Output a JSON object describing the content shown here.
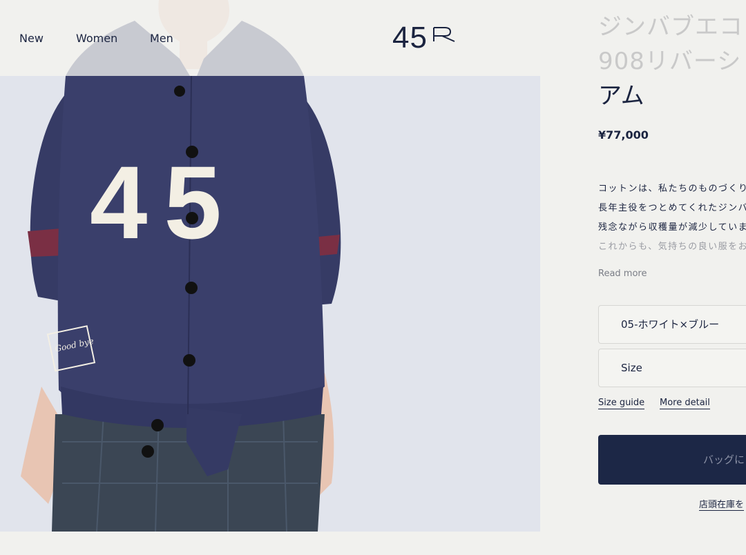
{
  "header": {
    "nav": [
      "New",
      "Women",
      "Men"
    ],
    "logo_text": "45",
    "logo_mark": "R"
  },
  "product": {
    "title_lines": [
      "ジンバブエコ",
      "908リバーシ",
      "アム"
    ],
    "price": "¥77,000",
    "description_lines": [
      "コットンは、私たちのものづくり",
      "長年主役をつとめてくれたジンバ",
      "残念ながら収穫量が減少していま",
      "これからも、気持ちの良い服をお"
    ],
    "read_more": "Read more",
    "color_select": "05-ホワイト×ブルー",
    "size_select": "Size",
    "size_guide": "Size guide",
    "more_detail": "More detail",
    "add_to_bag": "バッグに",
    "store_stock": "店頭在庫を"
  },
  "garment": {
    "chest_number": "45",
    "patch_text": "Good bye",
    "colors": {
      "jacket": "#3a3f6b",
      "felt": "#f3efe4",
      "lining": "#7a2f44",
      "trousers": "#3b4654",
      "background": "#e1e4ec",
      "brand_navy": "#1c2746"
    }
  }
}
